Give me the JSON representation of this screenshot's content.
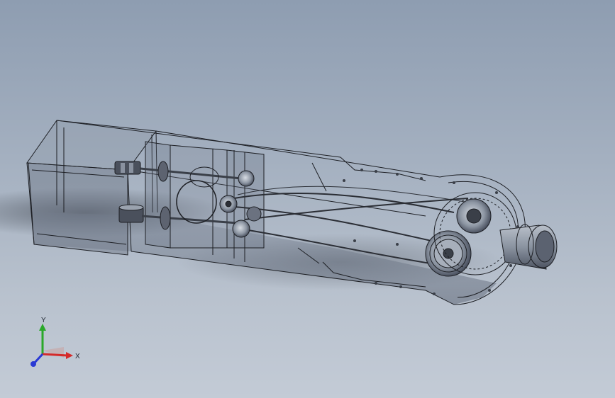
{
  "scene": {
    "background_top": "#8e9db1",
    "background_bottom": "#c3cbd6",
    "edge_color": "#1d1f24",
    "glass_color": "#7f8896"
  },
  "triad": {
    "x_label": "X",
    "y_label": "Y",
    "x_color": "#d42a2a",
    "y_color": "#2aa82a",
    "z_color": "#2a3ad4"
  }
}
